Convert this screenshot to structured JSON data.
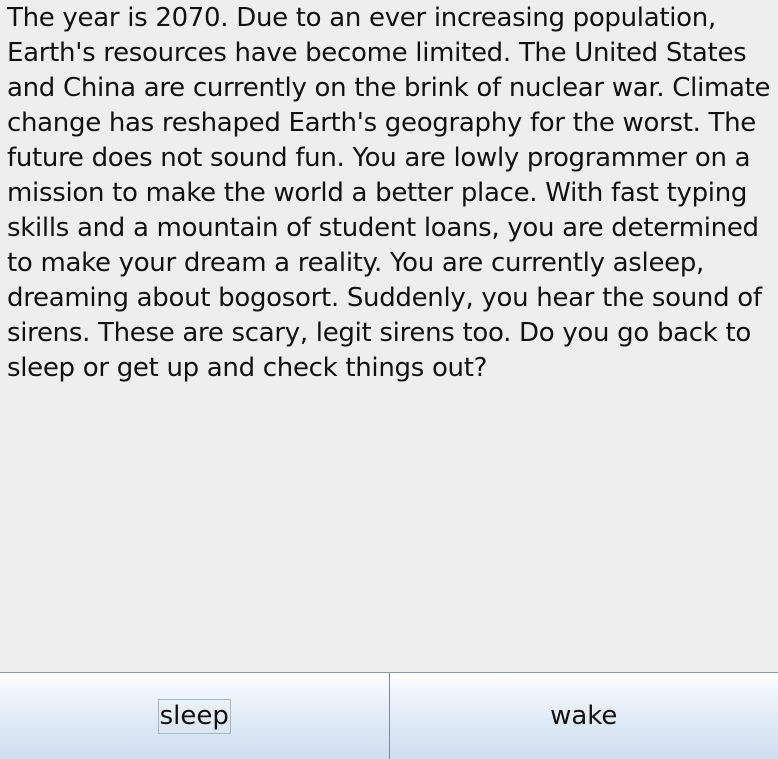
{
  "story": {
    "text": "The year is 2070. Due to an ever increasing population, Earth's resources have become limited. The United States and China are currently on the brink of nuclear war. Climate change has reshaped Earth's geography for the worst. The future does not sound fun. You are lowly programmer on a mission to make the world a better place. With fast typing skills and a mountain of student loans, you are determined to make your dream a reality. You are currently asleep, dreaming about bogosort. Suddenly, you hear the sound of sirens. These are scary, legit sirens too. Do you go back to sleep or get up and check things out?"
  },
  "choices": [
    {
      "label": "sleep",
      "focused": true
    },
    {
      "label": "wake",
      "focused": false
    }
  ]
}
